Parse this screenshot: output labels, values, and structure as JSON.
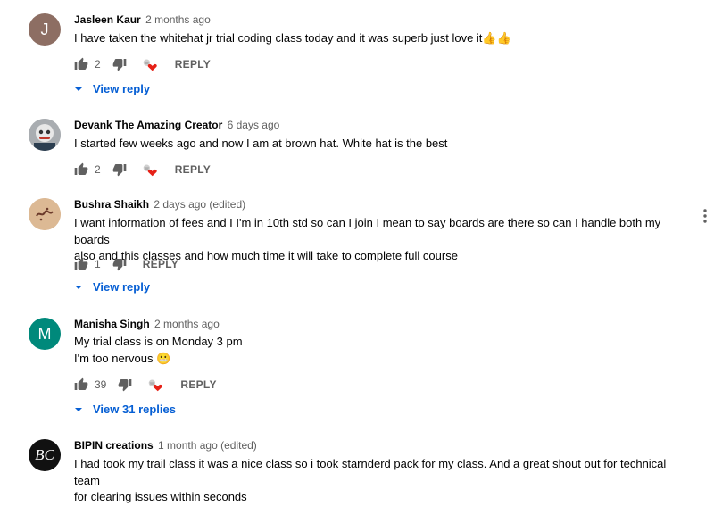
{
  "comments": [
    {
      "author": "Jasleen Kaur",
      "time": "2 months ago",
      "lines": [
        "I have taken the whitehat jr trial coding class today and it was superb just love it👍👍"
      ],
      "avatar": {
        "letter": "J",
        "color": "#8d6e63"
      },
      "likes": "2",
      "reply_label": "REPLY",
      "creator_heart": true,
      "view_replies": "View reply"
    },
    {
      "author": "Devank The Amazing Creator",
      "time": "6 days ago",
      "lines": [
        "I started few weeks ago and now I am at brown hat. White hat is the best"
      ],
      "avatar": {
        "letter": "",
        "color": "#9e9e9e"
      },
      "likes": "2",
      "reply_label": "REPLY",
      "creator_heart": true,
      "view_replies": ""
    },
    {
      "author": "Bushra Shaikh",
      "time": "2 days ago (edited)",
      "lines": [
        "I want information of fees and I I'm in 10th std so can I join I mean to say boards are there so can I handle both my boards",
        "also and this classes and how much time it will take to complete full course"
      ],
      "avatar": {
        "letter": "",
        "color": "#d9b48f"
      },
      "likes": "1",
      "reply_label": "REPLY",
      "creator_heart": false,
      "view_replies": "View reply"
    },
    {
      "author": "Manisha Singh",
      "time": "2 months ago",
      "lines": [
        "My trial class is on Monday 3 pm",
        "I'm too nervous 😬"
      ],
      "avatar": {
        "letter": "M",
        "color": "#00897b"
      },
      "likes": "39",
      "reply_label": "REPLY",
      "creator_heart": true,
      "view_replies": "View 31 replies"
    },
    {
      "author": "BIPIN creations",
      "time": "1 month ago (edited)",
      "lines": [
        "I had took my trail class it was a nice class so i took starnderd pack for my class. And a great shout out for technical team",
        "for clearing issues within seconds"
      ],
      "avatar": {
        "letter": "BC",
        "color": "#111111"
      },
      "likes": "",
      "reply_label": "",
      "creator_heart": false,
      "view_replies": ""
    }
  ]
}
